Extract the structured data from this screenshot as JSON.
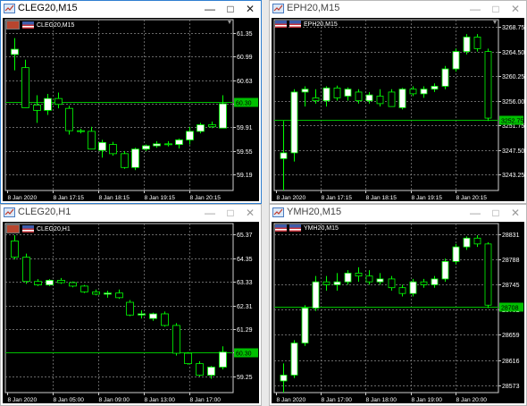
{
  "windows": [
    {
      "id": "tl",
      "title": "CLEG20,M15",
      "active": true,
      "chart_label": "CLEG20,M15",
      "flag_left": "commodity",
      "price_levels": [
        "61.35",
        "60.99",
        "60.63",
        "60.27",
        "59.91",
        "59.55",
        "59.19"
      ],
      "price_range": [
        58.95,
        61.55
      ],
      "current_price": "60.30",
      "time_labels": [
        "8 Jan 2020",
        "8 Jan 17:15",
        "8 Jan 18:15",
        "8 Jan 19:15",
        "8 Jan 20:15"
      ],
      "candles": [
        [
          61.02,
          61.27,
          60.78,
          61.1
        ],
        [
          60.82,
          60.94,
          60.21,
          60.21
        ],
        [
          60.25,
          60.4,
          59.98,
          60.17
        ],
        [
          60.17,
          60.42,
          60.1,
          60.35
        ],
        [
          60.35,
          60.44,
          60.2,
          60.26
        ],
        [
          60.2,
          60.24,
          59.8,
          59.86
        ],
        [
          59.86,
          59.89,
          59.82,
          59.85
        ],
        [
          59.85,
          59.92,
          59.58,
          59.58
        ],
        [
          59.56,
          59.72,
          59.45,
          59.68
        ],
        [
          59.65,
          59.69,
          59.48,
          59.51
        ],
        [
          59.51,
          59.55,
          59.28,
          59.3
        ],
        [
          59.3,
          59.6,
          59.26,
          59.58
        ],
        [
          59.58,
          59.65,
          59.55,
          59.63
        ],
        [
          59.63,
          59.7,
          59.6,
          59.66
        ],
        [
          59.66,
          59.7,
          59.62,
          59.65
        ],
        [
          59.65,
          59.74,
          59.59,
          59.72
        ],
        [
          59.72,
          59.92,
          59.65,
          59.85
        ],
        [
          59.85,
          59.98,
          59.82,
          59.95
        ],
        [
          59.95,
          60.0,
          59.9,
          59.92
        ],
        [
          59.9,
          60.4,
          59.9,
          60.27
        ]
      ]
    },
    {
      "id": "tr",
      "title": "EPH20,M15",
      "active": false,
      "chart_label": "EPH20,M15",
      "flag_left": "us",
      "price_levels": [
        "3268.75",
        "3264.50",
        "3260.25",
        "3256.00",
        "3251.75",
        "3247.50",
        "3243.25"
      ],
      "price_range": [
        3240.5,
        3270.0
      ],
      "current_price": "3252.75",
      "time_labels": [
        "8 Jan 2020",
        "8 Jan 17:15",
        "8 Jan 18:15",
        "8 Jan 19:15",
        "8 Jan 20:15"
      ],
      "candles": [
        [
          3246.0,
          3252.5,
          3240.5,
          3247.0
        ],
        [
          3247.0,
          3258.0,
          3245.5,
          3257.5
        ],
        [
          3257.5,
          3258.5,
          3255.0,
          3258.0
        ],
        [
          3256.5,
          3258.0,
          3255.5,
          3256.0
        ],
        [
          3256.0,
          3258.5,
          3255.0,
          3258.2
        ],
        [
          3258.2,
          3258.6,
          3256.0,
          3256.5
        ],
        [
          3256.8,
          3258.3,
          3256.0,
          3258.0
        ],
        [
          3257.5,
          3258.0,
          3255.5,
          3256.0
        ],
        [
          3256.0,
          3257.5,
          3255.5,
          3257.0
        ],
        [
          3256.8,
          3258.0,
          3255.0,
          3255.5
        ],
        [
          3257.5,
          3258.0,
          3255.0,
          3255.0
        ],
        [
          3254.8,
          3258.2,
          3254.5,
          3258.0
        ],
        [
          3258.0,
          3258.5,
          3256.8,
          3257.2
        ],
        [
          3257.2,
          3258.5,
          3256.5,
          3258.0
        ],
        [
          3258.0,
          3259.0,
          3257.5,
          3258.5
        ],
        [
          3258.5,
          3262.0,
          3258.0,
          3261.5
        ],
        [
          3261.5,
          3265.0,
          3261.0,
          3264.5
        ],
        [
          3264.5,
          3267.5,
          3264.0,
          3267.0
        ],
        [
          3267.0,
          3267.5,
          3264.5,
          3265.0
        ],
        [
          3264.5,
          3265.0,
          3252.5,
          3253.0
        ]
      ]
    },
    {
      "id": "bl",
      "title": "CLEG20,H1",
      "active": false,
      "chart_label": "CLEG20,H1",
      "flag_left": "commodity",
      "price_levels": [
        "65.37",
        "64.35",
        "63.33",
        "62.31",
        "61.29",
        "60.27",
        "59.25"
      ],
      "price_range": [
        58.55,
        65.85
      ],
      "current_price": "60.30",
      "time_labels": [
        "8 Jan 2020",
        "8 Jan 05:00",
        "8 Jan 09:00",
        "8 Jan 13:00",
        "8 Jan 17:00"
      ],
      "candles": [
        [
          65.1,
          65.35,
          64.3,
          64.4
        ],
        [
          64.4,
          64.55,
          63.25,
          63.35
        ],
        [
          63.35,
          63.45,
          63.15,
          63.2
        ],
        [
          63.2,
          63.45,
          63.15,
          63.4
        ],
        [
          63.4,
          63.5,
          63.25,
          63.3
        ],
        [
          63.3,
          63.35,
          63.1,
          63.15
        ],
        [
          63.15,
          63.2,
          62.85,
          62.9
        ],
        [
          62.9,
          63.0,
          62.75,
          62.8
        ],
        [
          62.8,
          62.95,
          62.65,
          62.85
        ],
        [
          62.85,
          63.0,
          62.6,
          62.65
        ],
        [
          62.45,
          62.55,
          61.85,
          61.9
        ],
        [
          61.9,
          62.1,
          61.75,
          61.95
        ],
        [
          61.75,
          62.0,
          61.65,
          61.95
        ],
        [
          61.95,
          62.05,
          61.4,
          61.45
        ],
        [
          61.45,
          61.55,
          60.15,
          60.25
        ],
        [
          60.25,
          60.3,
          59.75,
          59.8
        ],
        [
          59.8,
          59.9,
          59.25,
          59.3
        ],
        [
          59.3,
          59.7,
          59.15,
          59.65
        ],
        [
          59.65,
          60.55,
          59.55,
          60.3
        ]
      ]
    },
    {
      "id": "br",
      "title": "YMH20,M15",
      "active": false,
      "chart_label": "YMH20,M15",
      "flag_left": "us",
      "price_levels": [
        "28831",
        "28788",
        "28745",
        "28702",
        "28659",
        "28616",
        "28573"
      ],
      "price_range": [
        28560,
        28850
      ],
      "current_price": "28708",
      "time_labels": [
        "8 Jan 2020",
        "8 Jan 17:00",
        "8 Jan 18:00",
        "8 Jan 19:00",
        "8 Jan 20:00"
      ],
      "candles": [
        [
          28580,
          28610,
          28560,
          28590
        ],
        [
          28590,
          28650,
          28585,
          28645
        ],
        [
          28645,
          28710,
          28640,
          28705
        ],
        [
          28705,
          28760,
          28700,
          28750
        ],
        [
          28750,
          28760,
          28735,
          28745
        ],
        [
          28745,
          28765,
          28735,
          28750
        ],
        [
          28750,
          28770,
          28745,
          28765
        ],
        [
          28765,
          28775,
          28750,
          28760
        ],
        [
          28760,
          28770,
          28745,
          28750
        ],
        [
          28750,
          28765,
          28745,
          28755
        ],
        [
          28755,
          28760,
          28735,
          28740
        ],
        [
          28740,
          28745,
          28725,
          28730
        ],
        [
          28730,
          28755,
          28725,
          28750
        ],
        [
          28750,
          28755,
          28740,
          28745
        ],
        [
          28745,
          28760,
          28740,
          28755
        ],
        [
          28755,
          28790,
          28750,
          28785
        ],
        [
          28785,
          28815,
          28780,
          28810
        ],
        [
          28810,
          28828,
          28805,
          28825
        ],
        [
          28825,
          28830,
          28810,
          28815
        ],
        [
          28815,
          28818,
          28705,
          28710
        ]
      ]
    }
  ],
  "colors": {
    "background": "#000000",
    "grid": "#8a8a8a",
    "bull": "#ffffff",
    "bear": "#000000",
    "outline": "#00ff00",
    "price_line": "#00c000",
    "price_tag": "#00c000",
    "axis_text": "#ffffff"
  }
}
